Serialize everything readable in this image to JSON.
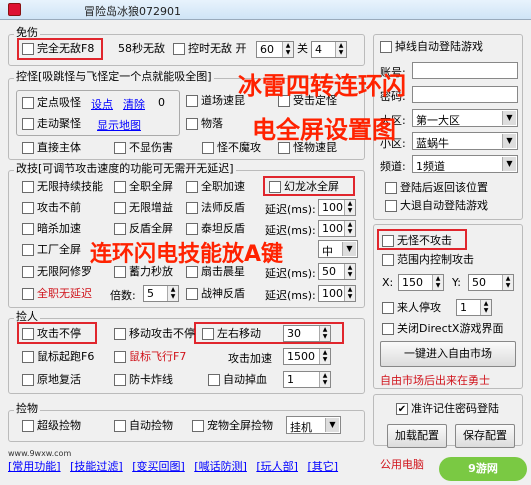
{
  "window": {
    "title": "冒险岛冰狼072901"
  },
  "invincible": {
    "title": "免伤",
    "full_invincible": "完全无敌F8",
    "sec58": "58秒无敌",
    "control_invincible": "控时无敌 开",
    "open_value": "60",
    "close_label": "关",
    "close_value": "4"
  },
  "monster": {
    "title": "控怪[吸跳怪与飞怪定一个点就能吸全图]",
    "fixed_suck": "定点吸怪",
    "set_point": "设点",
    "clear": "清除",
    "count": "0",
    "walk_gather": "走动聚怪",
    "show_map": "显示地图",
    "dungeon_speed": "道场速昆",
    "hit_pos_fix": "受击定怪",
    "item_drop": "物落",
    "hit_main": "直接主体",
    "no_injury": "不显伤害",
    "monster_no_magic": "怪不魔攻",
    "monster_speed": "怪物速昆"
  },
  "attack": {
    "title": "改技[可调节攻击速度的功能可无需开无延迟]",
    "row1": [
      "无限持续技能",
      "全职全屏",
      "全职加速",
      "幻龙冰全屏"
    ],
    "row2": [
      "攻击不前",
      "无限增益",
      "法师反盾"
    ],
    "row2_delay": "延迟(ms):",
    "row2_val": "100",
    "row3": [
      "暗杀加速",
      "反盾全屏",
      "泰坦反盾"
    ],
    "row3_delay": "延迟(ms):",
    "row3_val": "100",
    "row4": [
      "工厂全屏"
    ],
    "row4_sel": "中",
    "row5": [
      "无限阿修罗",
      "蓄力秒放",
      "扇击晨星"
    ],
    "row5_delay": "延迟(ms):",
    "row5_val": "50",
    "row6_a": "全职无延迟",
    "row6_mult": "倍数:",
    "row6_mult_val": "5",
    "row6_b": "战神反盾",
    "row6_delay": "延迟(ms):",
    "row6_val": "100"
  },
  "pick": {
    "title": "捡人",
    "atk_no_stop": "攻击不停",
    "move_atk_no_stop": "移动攻击不停",
    "lr_move": "左右移动",
    "lr_value": "30",
    "mouse_jump": "鼠标起跑F6",
    "mouse_fly": "鼠标飞行F7",
    "atk_speed_label": "攻击加速",
    "atk_speed_value": "1500",
    "revive": "原地复活",
    "anti_card": "防卡炸线",
    "auto_hp": "自动掉血",
    "auto_hp_value": "1"
  },
  "loot": {
    "title": "捡物",
    "super_loot": "超级捡物",
    "auto_loot": "自动捡物",
    "pet_loot": "宠物全屏捡物",
    "hang_option": "挂机"
  },
  "bottom_links": [
    "[常用功能]",
    "[技能过滤]",
    "[变买回图]",
    "[喊话防测]",
    "[玩人部]",
    "[其它]"
  ],
  "site_watermark": "www.9wxw.com",
  "right": {
    "reconnect": "掉线自动登陆游戏",
    "account_label": "账号:",
    "password_label": "密码:",
    "zone_label": "大区:",
    "zone_value": "第一大区",
    "server_label": "小区:",
    "server_value": "蓝蜗牛",
    "channel_label": "频道:",
    "channel_value": "1频道",
    "return_pos": "登陆后返回该位置",
    "auto_login": "大退自动登陆游戏",
    "no_monster_attack": "无怪不攻击",
    "range_attack": "范围内控制攻击",
    "x_label": "X:",
    "x_value": "150",
    "y_label": "Y:",
    "y_value": "50",
    "someone_stop": "来人停攻",
    "someone_value": "1",
    "close_directx": "关闭DirectX游戏界面",
    "enter_market": "一键进入自由市场",
    "market_note": "自由市场后出来在勇士",
    "remember_pwd": "准许记住密码登陆",
    "load_config": "加载配置",
    "save_config": "保存配置",
    "public_pc": "公用电脑"
  },
  "overlays": {
    "line1": "冰雷四转连环闪",
    "line2": "电全屏设置图",
    "line3": "连环闪电技能放A键"
  },
  "watermark": "9游网",
  "colors": {
    "highlight": "#e0262d",
    "overlay_text": "#ff2200",
    "red_text": "#d0141c"
  }
}
